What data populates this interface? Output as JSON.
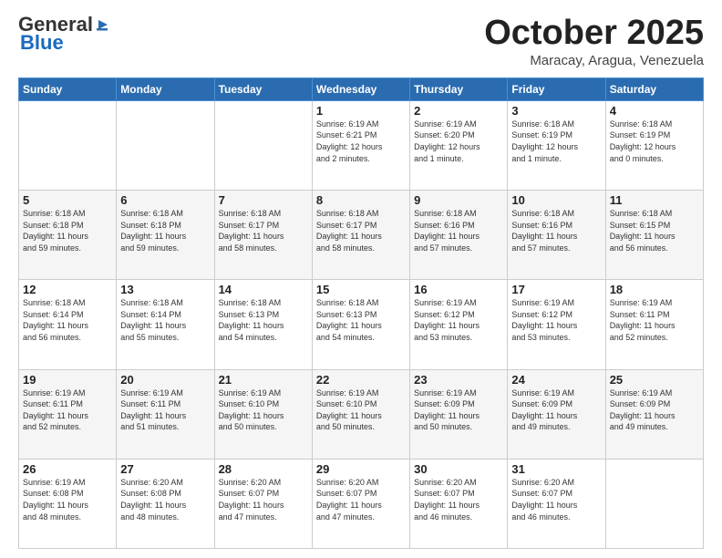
{
  "header": {
    "logo_general": "General",
    "logo_blue": "Blue",
    "month_title": "October 2025",
    "location": "Maracay, Aragua, Venezuela"
  },
  "weekdays": [
    "Sunday",
    "Monday",
    "Tuesday",
    "Wednesday",
    "Thursday",
    "Friday",
    "Saturday"
  ],
  "weeks": [
    [
      {
        "day": "",
        "info": ""
      },
      {
        "day": "",
        "info": ""
      },
      {
        "day": "",
        "info": ""
      },
      {
        "day": "1",
        "info": "Sunrise: 6:19 AM\nSunset: 6:21 PM\nDaylight: 12 hours\nand 2 minutes."
      },
      {
        "day": "2",
        "info": "Sunrise: 6:19 AM\nSunset: 6:20 PM\nDaylight: 12 hours\nand 1 minute."
      },
      {
        "day": "3",
        "info": "Sunrise: 6:18 AM\nSunset: 6:19 PM\nDaylight: 12 hours\nand 1 minute."
      },
      {
        "day": "4",
        "info": "Sunrise: 6:18 AM\nSunset: 6:19 PM\nDaylight: 12 hours\nand 0 minutes."
      }
    ],
    [
      {
        "day": "5",
        "info": "Sunrise: 6:18 AM\nSunset: 6:18 PM\nDaylight: 11 hours\nand 59 minutes."
      },
      {
        "day": "6",
        "info": "Sunrise: 6:18 AM\nSunset: 6:18 PM\nDaylight: 11 hours\nand 59 minutes."
      },
      {
        "day": "7",
        "info": "Sunrise: 6:18 AM\nSunset: 6:17 PM\nDaylight: 11 hours\nand 58 minutes."
      },
      {
        "day": "8",
        "info": "Sunrise: 6:18 AM\nSunset: 6:17 PM\nDaylight: 11 hours\nand 58 minutes."
      },
      {
        "day": "9",
        "info": "Sunrise: 6:18 AM\nSunset: 6:16 PM\nDaylight: 11 hours\nand 57 minutes."
      },
      {
        "day": "10",
        "info": "Sunrise: 6:18 AM\nSunset: 6:16 PM\nDaylight: 11 hours\nand 57 minutes."
      },
      {
        "day": "11",
        "info": "Sunrise: 6:18 AM\nSunset: 6:15 PM\nDaylight: 11 hours\nand 56 minutes."
      }
    ],
    [
      {
        "day": "12",
        "info": "Sunrise: 6:18 AM\nSunset: 6:14 PM\nDaylight: 11 hours\nand 56 minutes."
      },
      {
        "day": "13",
        "info": "Sunrise: 6:18 AM\nSunset: 6:14 PM\nDaylight: 11 hours\nand 55 minutes."
      },
      {
        "day": "14",
        "info": "Sunrise: 6:18 AM\nSunset: 6:13 PM\nDaylight: 11 hours\nand 54 minutes."
      },
      {
        "day": "15",
        "info": "Sunrise: 6:18 AM\nSunset: 6:13 PM\nDaylight: 11 hours\nand 54 minutes."
      },
      {
        "day": "16",
        "info": "Sunrise: 6:19 AM\nSunset: 6:12 PM\nDaylight: 11 hours\nand 53 minutes."
      },
      {
        "day": "17",
        "info": "Sunrise: 6:19 AM\nSunset: 6:12 PM\nDaylight: 11 hours\nand 53 minutes."
      },
      {
        "day": "18",
        "info": "Sunrise: 6:19 AM\nSunset: 6:11 PM\nDaylight: 11 hours\nand 52 minutes."
      }
    ],
    [
      {
        "day": "19",
        "info": "Sunrise: 6:19 AM\nSunset: 6:11 PM\nDaylight: 11 hours\nand 52 minutes."
      },
      {
        "day": "20",
        "info": "Sunrise: 6:19 AM\nSunset: 6:11 PM\nDaylight: 11 hours\nand 51 minutes."
      },
      {
        "day": "21",
        "info": "Sunrise: 6:19 AM\nSunset: 6:10 PM\nDaylight: 11 hours\nand 50 minutes."
      },
      {
        "day": "22",
        "info": "Sunrise: 6:19 AM\nSunset: 6:10 PM\nDaylight: 11 hours\nand 50 minutes."
      },
      {
        "day": "23",
        "info": "Sunrise: 6:19 AM\nSunset: 6:09 PM\nDaylight: 11 hours\nand 50 minutes."
      },
      {
        "day": "24",
        "info": "Sunrise: 6:19 AM\nSunset: 6:09 PM\nDaylight: 11 hours\nand 49 minutes."
      },
      {
        "day": "25",
        "info": "Sunrise: 6:19 AM\nSunset: 6:09 PM\nDaylight: 11 hours\nand 49 minutes."
      }
    ],
    [
      {
        "day": "26",
        "info": "Sunrise: 6:19 AM\nSunset: 6:08 PM\nDaylight: 11 hours\nand 48 minutes."
      },
      {
        "day": "27",
        "info": "Sunrise: 6:20 AM\nSunset: 6:08 PM\nDaylight: 11 hours\nand 48 minutes."
      },
      {
        "day": "28",
        "info": "Sunrise: 6:20 AM\nSunset: 6:07 PM\nDaylight: 11 hours\nand 47 minutes."
      },
      {
        "day": "29",
        "info": "Sunrise: 6:20 AM\nSunset: 6:07 PM\nDaylight: 11 hours\nand 47 minutes."
      },
      {
        "day": "30",
        "info": "Sunrise: 6:20 AM\nSunset: 6:07 PM\nDaylight: 11 hours\nand 46 minutes."
      },
      {
        "day": "31",
        "info": "Sunrise: 6:20 AM\nSunset: 6:07 PM\nDaylight: 11 hours\nand 46 minutes."
      },
      {
        "day": "",
        "info": ""
      }
    ]
  ]
}
